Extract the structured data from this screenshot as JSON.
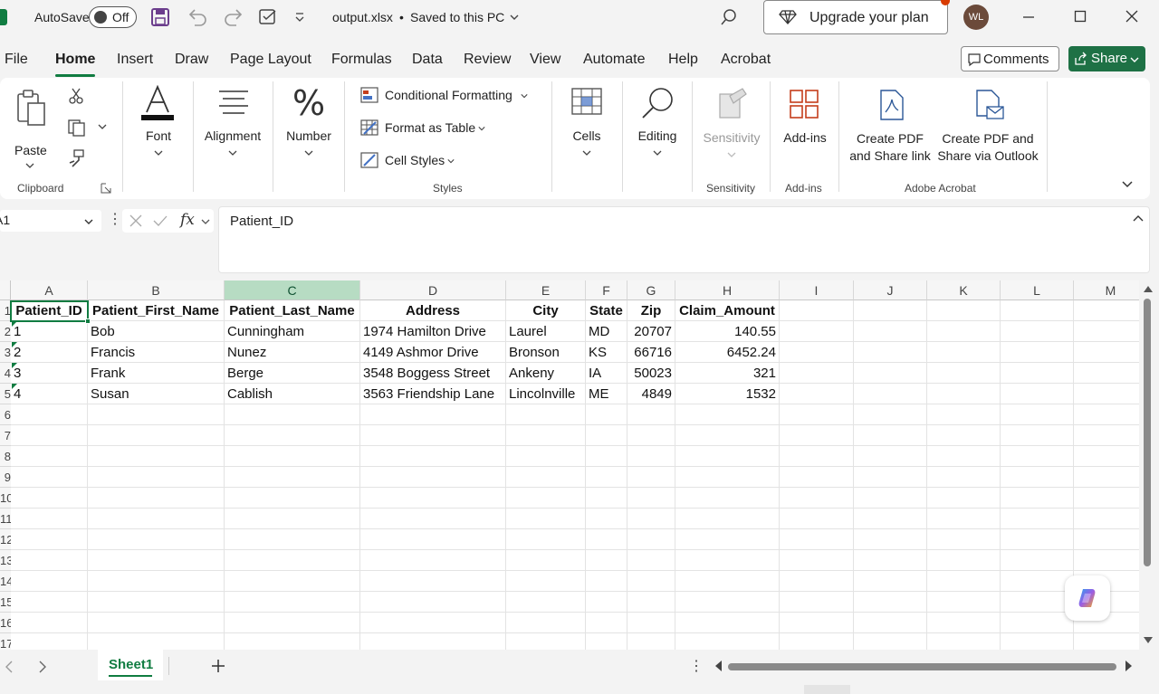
{
  "titlebar": {
    "autosave_label": "AutoSave",
    "autosave_state": "Off",
    "filename": "output.xlsx",
    "save_status": "Saved to this PC",
    "upgrade_label": "Upgrade your plan",
    "avatar_initials": "WL"
  },
  "menu": {
    "tabs": [
      "File",
      "Home",
      "Insert",
      "Draw",
      "Page Layout",
      "Formulas",
      "Data",
      "Review",
      "View",
      "Automate",
      "Help",
      "Acrobat"
    ],
    "active": "Home",
    "comments_label": "Comments",
    "share_label": "Share"
  },
  "ribbon": {
    "paste_label": "Paste",
    "clipboard_group": "Clipboard",
    "font_label": "Font",
    "alignment_label": "Alignment",
    "number_label": "Number",
    "conditional_formatting": "Conditional Formatting",
    "format_as_table": "Format as Table",
    "cell_styles": "Cell Styles",
    "styles_group": "Styles",
    "cells_label": "Cells",
    "editing_label": "Editing",
    "sensitivity_label": "Sensitivity",
    "sensitivity_group": "Sensitivity",
    "addins_label": "Add-ins",
    "addins_group": "Add-ins",
    "create_pdf_share_link_1": "Create PDF",
    "create_pdf_share_link_2": "and Share link",
    "create_pdf_outlook_1": "Create PDF and",
    "create_pdf_outlook_2": "Share via Outlook",
    "acrobat_group": "Adobe Acrobat"
  },
  "formula_bar": {
    "name_box": "A1",
    "fx": "fx",
    "content": "Patient_ID"
  },
  "grid": {
    "columns": [
      "A",
      "B",
      "C",
      "D",
      "E",
      "F",
      "G",
      "H",
      "I",
      "J",
      "K",
      "L",
      "M"
    ],
    "row_numbers": [
      "1",
      "2",
      "3",
      "4",
      "5",
      "6",
      "7",
      "8",
      "9",
      "10",
      "11",
      "12",
      "13",
      "14",
      "15",
      "16",
      "17"
    ],
    "headers": [
      "Patient_ID",
      "Patient_First_Name",
      "Patient_Last_Name",
      "Address",
      "City",
      "State",
      "Zip",
      "Claim_Amount"
    ],
    "rows": [
      [
        "1",
        "Bob",
        "Cunningham",
        "1974 Hamilton Drive",
        "Laurel",
        "MD",
        "20707",
        "140.55"
      ],
      [
        "2",
        "Francis",
        "Nunez",
        "4149 Ashmor Drive",
        "Bronson",
        "KS",
        "66716",
        "6452.24"
      ],
      [
        "3",
        "Frank",
        "Berge",
        "3548 Boggess Street",
        "Ankeny",
        "IA",
        "50023",
        "321"
      ],
      [
        "4",
        "Susan",
        "Cablish",
        "3563 Friendship Lane",
        "Lincolnville",
        "ME",
        "4849",
        "1532"
      ]
    ]
  },
  "sheets": {
    "tabs": [
      "Sheet1"
    ],
    "active": "Sheet1"
  },
  "colors": {
    "excel_green": "#107c41",
    "share_green": "#1e7145",
    "selected_col_header": "#b7dcc3"
  }
}
